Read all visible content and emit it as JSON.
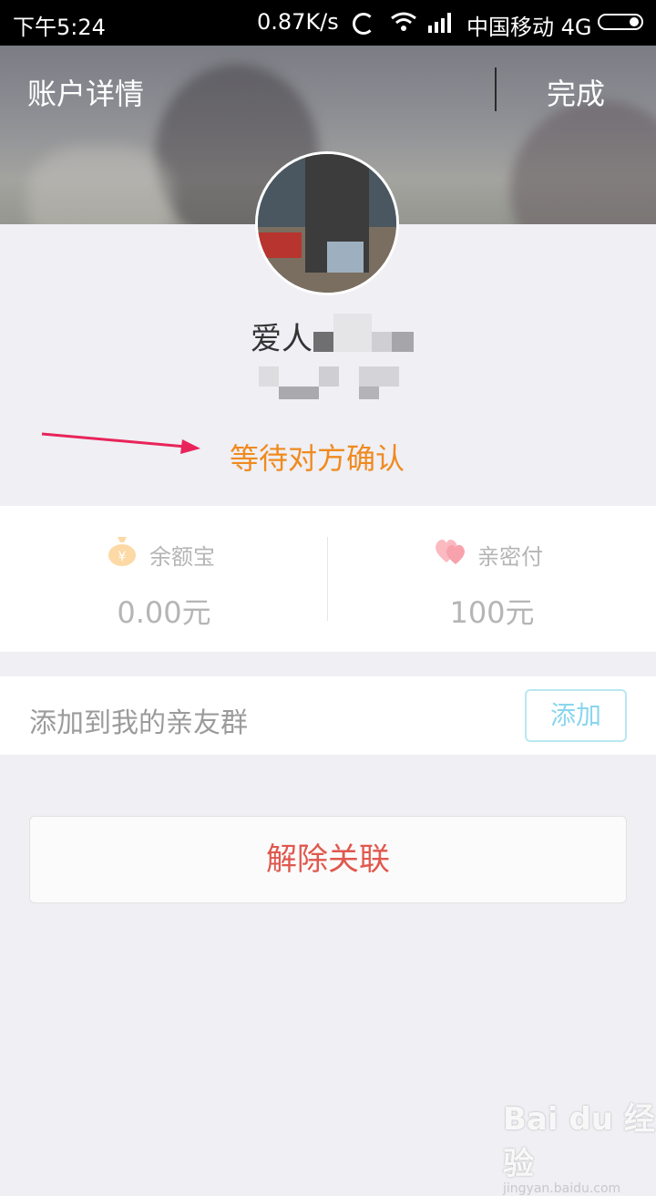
{
  "status_bar": {
    "time": "下午5:24",
    "network_speed": "0.87K/s",
    "carrier": "中国移动 4G"
  },
  "header": {
    "title": "账户详情",
    "done_label": "完成"
  },
  "profile": {
    "name_visible": "爱人",
    "status": "等待对方确认"
  },
  "stats": {
    "left": {
      "icon": "moneybag-icon",
      "label": "余额宝",
      "value": "0.00元"
    },
    "right": {
      "icon": "heart-icon",
      "label": "亲密付",
      "value": "100元"
    }
  },
  "add_group": {
    "label": "添加到我的亲友群",
    "button_label": "添加"
  },
  "unlink_button": "解除关联",
  "watermark": {
    "brand": "Bai du 经验",
    "url": "jingyan.baidu.com"
  },
  "colors": {
    "status_orange": "#f08a1e",
    "unlink_red": "#e0584e",
    "add_button_blue": "#8ad6ee",
    "arrow_pink": "#e8245a"
  }
}
